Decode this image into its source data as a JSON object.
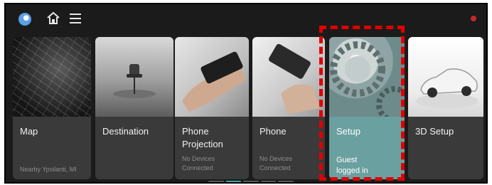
{
  "topbar": {
    "icons": [
      "globe-icon",
      "home-icon",
      "menu-icon"
    ],
    "status_color": "#c62828"
  },
  "cards": [
    {
      "id": "map",
      "title": "Map",
      "subtitle": "Nearby Ypsilanti, MI"
    },
    {
      "id": "destination",
      "title": "Destination",
      "subtitle": ""
    },
    {
      "id": "phone-projection",
      "title": "Phone Projection",
      "subtitle": "No Devices Connected"
    },
    {
      "id": "phone",
      "title": "Phone",
      "subtitle": "No Devices Connected"
    },
    {
      "id": "setup",
      "title": "Setup",
      "subtitle": "Guest logged in"
    },
    {
      "id": "3d-setup",
      "title": "3D Setup",
      "subtitle": ""
    }
  ],
  "highlight_color": "#e00000",
  "accent_color": "#3fa6a6",
  "pager": {
    "count": 5,
    "active_index": 1
  }
}
